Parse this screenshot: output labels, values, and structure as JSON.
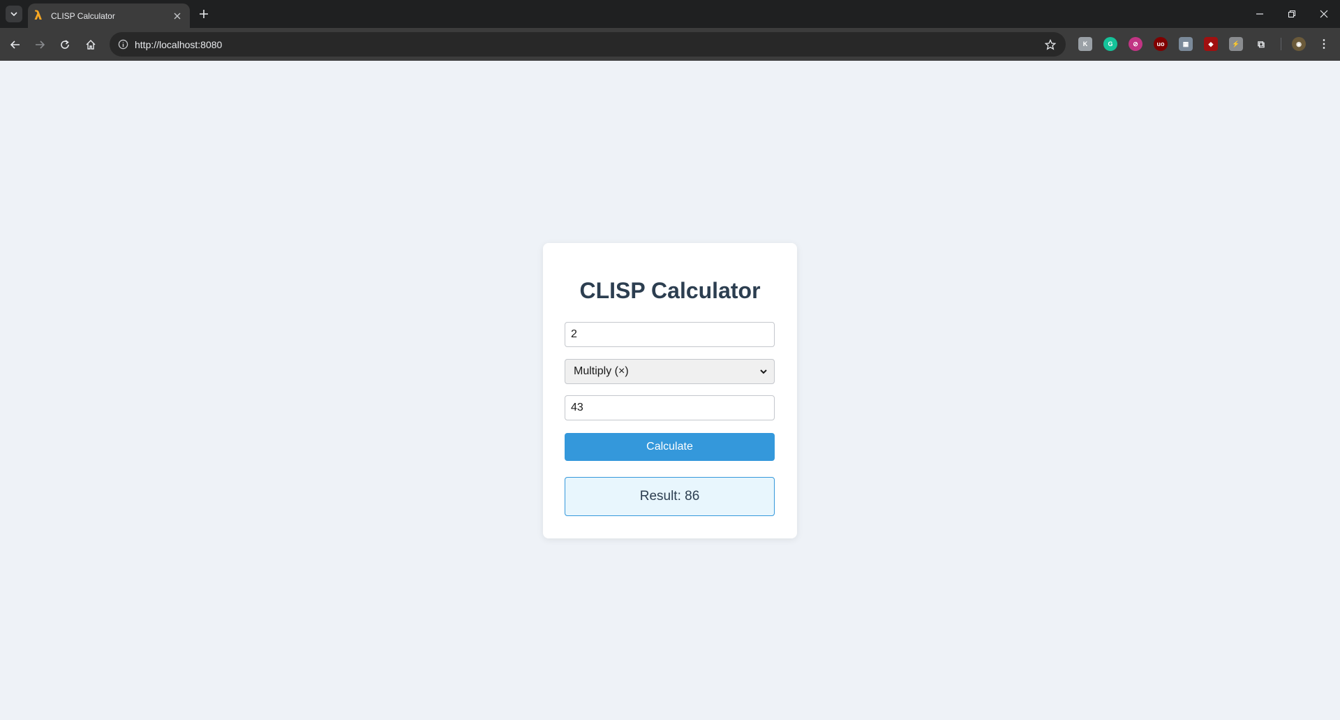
{
  "browser": {
    "tab_title": "CLISP Calculator",
    "url": "http://localhost:8080"
  },
  "page": {
    "heading": "CLISP Calculator",
    "first_number": "2",
    "operation": "Multiply (×)",
    "second_number": "43",
    "calculate_label": "Calculate",
    "result_text": "Result: 86"
  },
  "colors": {
    "accent": "#3498db",
    "heading": "#2c3e50",
    "result_bg": "#e8f6fd",
    "page_bg": "#eef2f7"
  }
}
